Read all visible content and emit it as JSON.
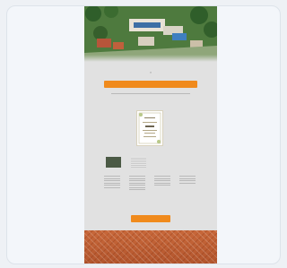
{
  "colors": {
    "accent": "#f08a1c",
    "page_background": "#e1e1e1",
    "card_background": "#f3f6fa"
  },
  "header": {
    "image": "resort-aerial-photo"
  },
  "intro": {
    "cta_label": "",
    "subtitle": ""
  },
  "invitation": {
    "image": "wedding-invitation-card"
  },
  "columns": [
    {
      "heading": ""
    },
    {
      "heading": ""
    },
    {
      "heading": ""
    },
    {
      "heading": ""
    }
  ],
  "footer_cta": {
    "label": ""
  },
  "footer": {
    "image": "orange-tile-roof-pattern"
  }
}
